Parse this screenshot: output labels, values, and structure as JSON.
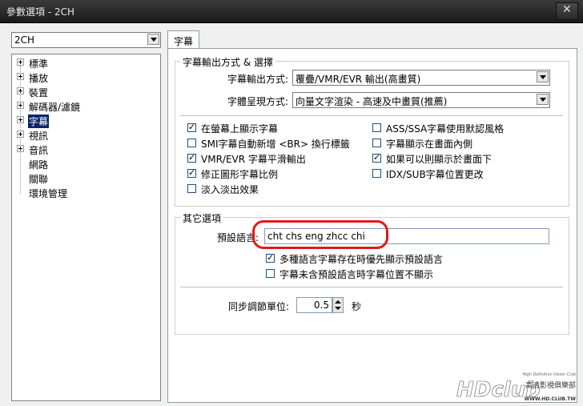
{
  "window": {
    "title": "參數選項 - 2CH",
    "close_glyph": "✕"
  },
  "profile": {
    "selected": "2CH"
  },
  "sidebar": {
    "items": [
      {
        "label": "標準",
        "expandable": true
      },
      {
        "label": "播放",
        "expandable": true
      },
      {
        "label": "裝置",
        "expandable": true
      },
      {
        "label": "解碼器/濾鏡",
        "expandable": true
      },
      {
        "label": "字幕",
        "expandable": true,
        "selected": true
      },
      {
        "label": "視訊",
        "expandable": true
      },
      {
        "label": "音訊",
        "expandable": true
      },
      {
        "label": "網路",
        "expandable": false
      },
      {
        "label": "關聯",
        "expandable": false
      },
      {
        "label": "環境管理",
        "expandable": false
      }
    ]
  },
  "tab": {
    "label": "字幕"
  },
  "output_group": {
    "title": "字幕輸出方式 & 選擇",
    "output_mode_label": "字幕輸出方式:",
    "output_mode_value": "覆疊/VMR/EVR 輸出(高畫質)",
    "font_render_label": "字體呈現方式:",
    "font_render_value": "向量文字渲染 - 高速及中畫質(推薦)",
    "options": [
      {
        "label": "在螢幕上顯示字幕",
        "checked": true
      },
      {
        "label": "SMI字幕自動新增 <BR> 換行標籤",
        "checked": false
      },
      {
        "label": "VMR/EVR 字幕平滑輸出",
        "checked": true
      },
      {
        "label": "修正圖形字幕比例",
        "checked": true
      },
      {
        "label": "淡入淡出效果",
        "checked": false
      },
      {
        "label": "ASS/SSA字幕使用默認風格",
        "checked": false
      },
      {
        "label": "字幕顯示在畫面內側",
        "checked": false
      },
      {
        "label": "如果可以則顯示於畫面下",
        "checked": true
      },
      {
        "label": "IDX/SUB字幕位置更改",
        "checked": false
      }
    ]
  },
  "other_group": {
    "title": "其它選項",
    "language_label": "預設語言:",
    "language_value": "cht chs eng zhcc chi",
    "priority_option": {
      "label": "多種語言字幕存在時優先顯示預設語言",
      "checked": true
    },
    "hide_option": {
      "label": "字幕未含預設語言時字幕位置不顯示",
      "checked": false
    },
    "sync_label": "同步調節單位:",
    "sync_value": "0.5",
    "sync_unit": "秒"
  },
  "watermark": {
    "tagline": "High Definition Vision Club",
    "brand": "HDclub",
    "sub": "高清影視俱樂部",
    "url": "WWW.HD.CLUB.TW"
  },
  "colors": {
    "selection": "#0a246a",
    "annotation": "#e01a1a"
  }
}
